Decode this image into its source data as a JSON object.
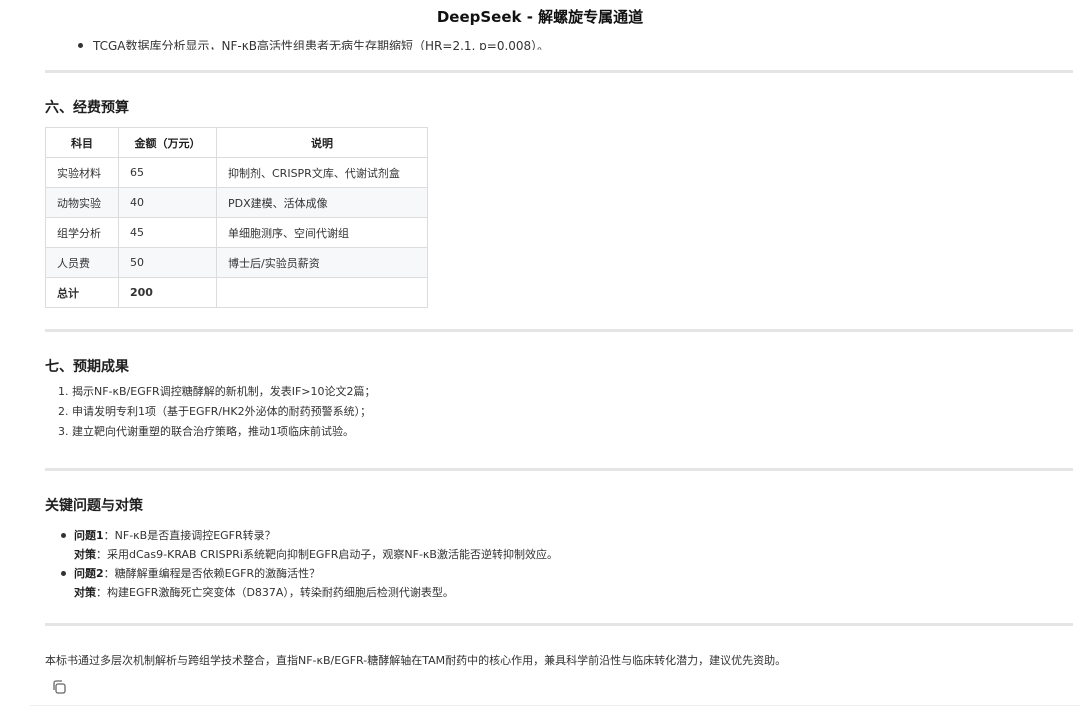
{
  "app": {
    "title": "DeepSeek - 解螺旋专属通道"
  },
  "cut_text": "TCGA数据库分析显示，NF-κB高活性组患者无病生存期缩短（HR=2.1, p=0.008）。",
  "budget": {
    "heading": "六、经费预算",
    "headers": [
      "科目",
      "金额（万元）",
      "说明"
    ],
    "rows": [
      [
        "实验材料",
        "65",
        "抑制剂、CRISPR文库、代谢试剂盒"
      ],
      [
        "动物实验",
        "40",
        "PDX建模、活体成像"
      ],
      [
        "组学分析",
        "45",
        "单细胞测序、空间代谢组"
      ],
      [
        "人员费",
        "50",
        "博士后/实验员薪资"
      ],
      [
        "总计",
        "200",
        ""
      ]
    ]
  },
  "results": {
    "heading": "七、预期成果",
    "items": [
      "1. 揭示NF-κB/EGFR调控糖酵解的新机制，发表IF>10论文2篇；",
      "2. 申请发明专利1项（基于EGFR/HK2外泌体的耐药预警系统）；",
      "3. 建立靶向代谢重塑的联合治疗策略，推动1项临床前试验。"
    ]
  },
  "qa": {
    "heading": "关键问题与对策",
    "items": [
      {
        "q_label": "问题1",
        "q_text": "：NF-κB是否直接调控EGFR转录？",
        "a_label": "对策",
        "a_text": "：采用dCas9-KRAB CRISPRi系统靶向抑制EGFR启动子，观察NF-κB激活能否逆转抑制效应。"
      },
      {
        "q_label": "问题2",
        "q_text": "：糖酵解重编程是否依赖EGFR的激酶活性？",
        "a_label": "对策",
        "a_text": "：构建EGFR激酶死亡突变体（D837A），转染耐药细胞后检测代谢表型。"
      }
    ]
  },
  "summary": "本标书通过多层次机制解析与跨组学技术整合，直指NF-κB/EGFR-糖酵解轴在TAM耐药中的核心作用，兼具科学前沿性与临床转化潜力，建议优先资助。",
  "icons": {
    "copy": "copy-icon"
  }
}
